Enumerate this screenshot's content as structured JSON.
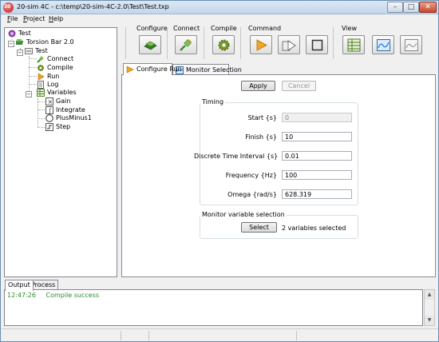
{
  "window": {
    "title": "20-sim 4C - c:\\temp\\20-sim-4C-2.0\\Test\\Test.txp"
  },
  "menu": [
    "File",
    "Project",
    "Help"
  ],
  "menu_underline": [
    "F",
    "P",
    "H"
  ],
  "menu_rest": [
    "ile",
    "roject",
    "elp"
  ],
  "tree": {
    "root": "Test",
    "target": "Torsion Bar 2.0",
    "model": "Test",
    "actions": [
      "Connect",
      "Compile",
      "Run",
      "Log"
    ],
    "variables": "Variables",
    "submodels": [
      "Gain",
      "Integrate",
      "PlusMinus1",
      "Step"
    ]
  },
  "toolbar": {
    "groups": {
      "configure": "Configure",
      "connect": "Connect",
      "compile": "Compile",
      "command": "Command",
      "view": "View"
    },
    "icons": {
      "configure": "configure-board-icon",
      "connect": "connect-plug-icon",
      "compile": "compile-gear-icon",
      "run": "play-icon",
      "monitor": "monitor-run-icon",
      "stop": "stop-icon",
      "view1": "view-tree-icon",
      "view2": "view-monitor-icon",
      "view3": "view-plot-icon"
    }
  },
  "tabs": {
    "configure_run": "Configure Run",
    "monitor_selection": "Monitor Selection"
  },
  "configure": {
    "apply_label": "Apply",
    "cancel_label": "Cancel",
    "timing_title": "Timing",
    "fields": [
      {
        "label": "Start {s}",
        "value": "0"
      },
      {
        "label": "Finish {s}",
        "value": "10"
      },
      {
        "label": "Discrete Time Interval {s}",
        "value": "0.01"
      },
      {
        "label": "Frequency {Hz}",
        "value": "100"
      },
      {
        "label": "Omega {rad/s}",
        "value": "628.319"
      }
    ],
    "monitor_title": "Monitor variable selection",
    "select_label": "Select",
    "selected_text": "2 variables selected"
  },
  "output": {
    "tabs": [
      "Output",
      "Process"
    ],
    "log": [
      {
        "time": "12:47:26",
        "message": "Compile success"
      }
    ]
  },
  "colors": {
    "log_success": "#2e8b2e",
    "title_bar": "#c3d6ea"
  }
}
